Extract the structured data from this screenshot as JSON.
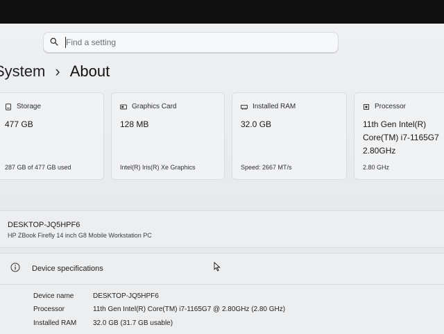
{
  "search": {
    "placeholder": "Find a setting"
  },
  "breadcrumb": {
    "parent": "System",
    "separator": "›",
    "current": "About"
  },
  "cards": [
    {
      "icon": "storage-icon",
      "title": "Storage",
      "value": "477 GB",
      "sub": "287 GB of 477 GB used"
    },
    {
      "icon": "graphics-card-icon",
      "title": "Graphics Card",
      "value": "128 MB",
      "sub": "Intel(R) Iris(R) Xe Graphics"
    },
    {
      "icon": "ram-icon",
      "title": "Installed RAM",
      "value": "32.0 GB",
      "sub": "Speed: 2667 MT/s"
    },
    {
      "icon": "processor-icon",
      "title": "Processor",
      "value": "11th Gen Intel(R) Core(TM) i7-1165G7 2.80GHz",
      "sub": "2.80 GHz"
    }
  ],
  "device": {
    "name": "DESKTOP-JQ5HPF6",
    "model": "HP ZBook Firefly 14 inch G8 Mobile Workstation PC"
  },
  "specs": {
    "title": "Device specifications",
    "rows": [
      {
        "label": "Device name",
        "value": "DESKTOP-JQ5HPF6"
      },
      {
        "label": "Processor",
        "value": "11th Gen Intel(R) Core(TM) i7-1165G7 @ 2.80GHz (2.80 GHz)"
      },
      {
        "label": "Installed RAM",
        "value": "32.0 GB (31.7 GB usable)"
      }
    ]
  }
}
